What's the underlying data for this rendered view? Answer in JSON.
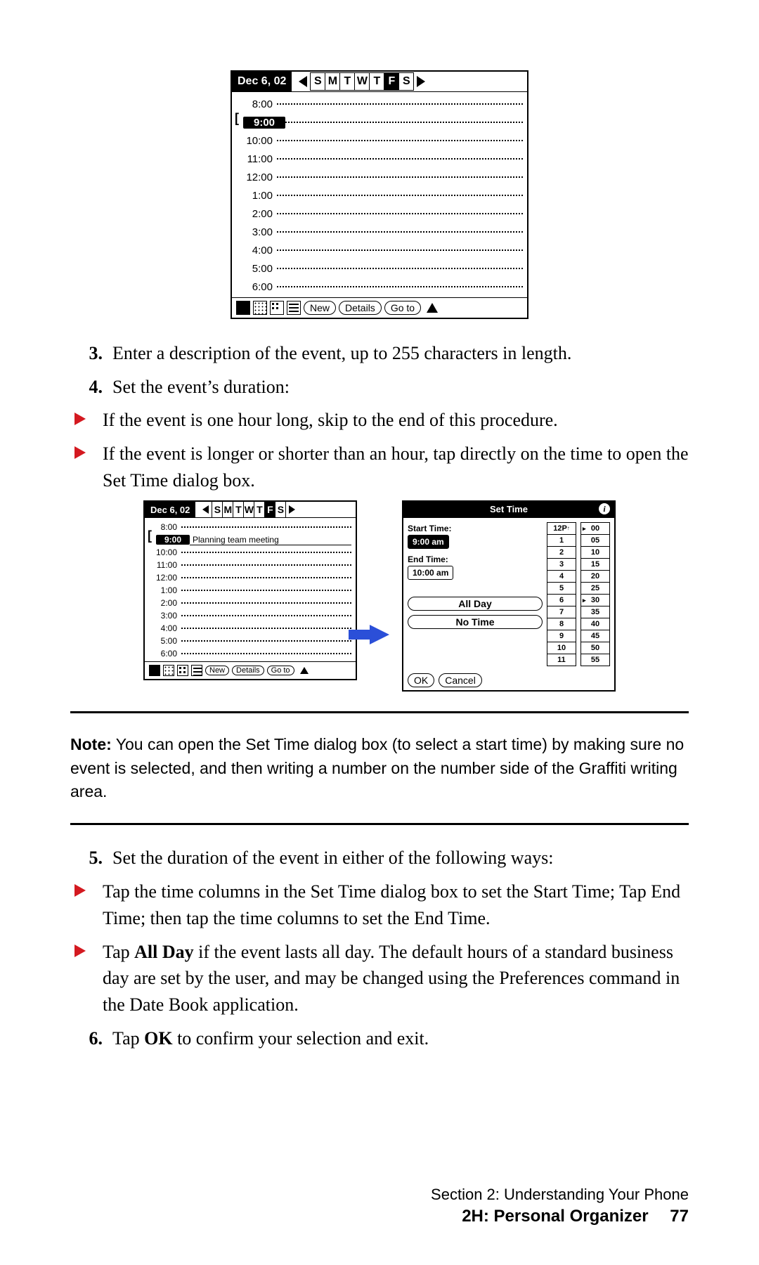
{
  "pda": {
    "date": "Dec 6, 02",
    "days": [
      "S",
      "M",
      "T",
      "W",
      "T",
      "F",
      "S"
    ],
    "selected_day_index": 5,
    "hours": [
      "8:00",
      "9:00",
      "10:00",
      "11:00",
      "12:00",
      "1:00",
      "2:00",
      "3:00",
      "4:00",
      "5:00",
      "6:00"
    ],
    "selected_hour": "9:00",
    "event_text": "Planning team meeting",
    "buttons": {
      "new": "New",
      "details": "Details",
      "goto": "Go to"
    }
  },
  "settime": {
    "title": "Set Time",
    "start_label": "Start Time:",
    "start_value": "9:00 am",
    "end_label": "End Time:",
    "end_value": "10:00 am",
    "allday": "All Day",
    "notime": "No Time",
    "ok": "OK",
    "cancel": "Cancel",
    "hours_col": [
      "12P",
      "1",
      "2",
      "3",
      "4",
      "5",
      "6",
      "7",
      "8",
      "9",
      "10",
      "11"
    ],
    "mins_col": [
      "00",
      "05",
      "10",
      "15",
      "20",
      "25",
      "30",
      "35",
      "40",
      "45",
      "50",
      "55"
    ],
    "hour_sel_index": 0,
    "min_sel_index": 0
  },
  "steps": {
    "s3": "Enter a description of the event, up to 255 characters in length.",
    "s4": "Set the event’s duration:",
    "b4a": "If the event is one hour long, skip to the end of this procedure.",
    "b4b": "If the event is longer or shorter than an hour, tap directly on the time to open the Set Time dialog box.",
    "s5": "Set the duration of the event in either of the following ways:",
    "b5a": "Tap the time columns in the Set Time dialog box to set the Start Time; Tap End Time; then tap the time columns to set the End Time.",
    "b5b_pre": "Tap ",
    "b5b_bold": "All Day",
    "b5b_post": " if the event lasts all day. The default hours of a standard business day are set by the user, and may be changed using the Preferences command in the Date Book application.",
    "s6_pre": "Tap ",
    "s6_bold": "OK",
    "s6_post": " to confirm your selection and exit."
  },
  "note": {
    "label": "Note:",
    "text": " You can open the Set Time dialog box (to select a start time) by making sure no event is selected, and then writing a number on the number side of the Graffiti writing area."
  },
  "footer": {
    "line1": "Section 2: Understanding Your Phone",
    "line2": "2H: Personal Organizer",
    "page": "77"
  }
}
